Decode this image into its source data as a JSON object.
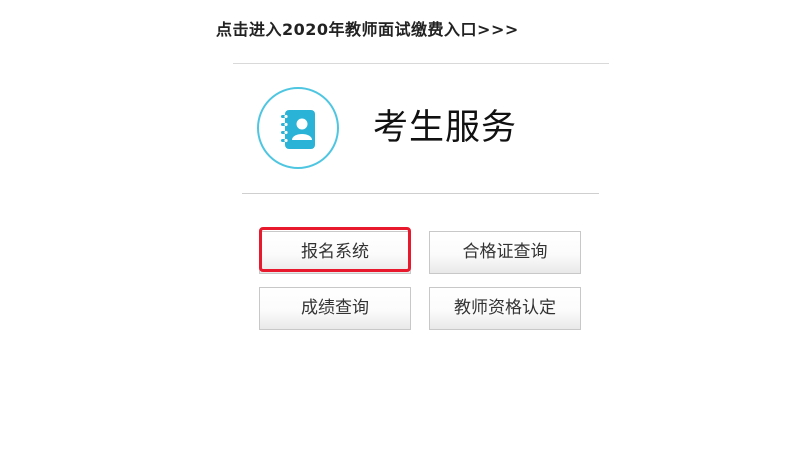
{
  "header": {
    "payment_link": "点击进入2020年教师面试缴费入口>>>"
  },
  "service": {
    "icon": "address-book-icon",
    "title": "考生服务"
  },
  "buttons": [
    {
      "label": "报名系统"
    },
    {
      "label": "合格证查询"
    },
    {
      "label": "成绩查询"
    },
    {
      "label": "教师资格认定"
    }
  ],
  "colors": {
    "icon_accent": "#4fc6e1",
    "highlight": "#e8192c"
  }
}
